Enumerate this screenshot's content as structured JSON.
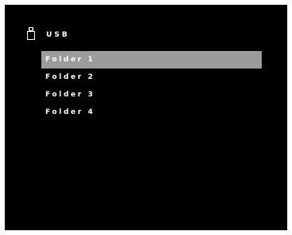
{
  "header": {
    "icon": "usb-drive-icon",
    "title": "USB"
  },
  "folders": [
    {
      "label": "Folder 1",
      "selected": true
    },
    {
      "label": "Folder 2",
      "selected": false
    },
    {
      "label": "Folder 3",
      "selected": false
    },
    {
      "label": "Folder 4",
      "selected": false
    }
  ],
  "colors": {
    "background": "#000000",
    "text": "#ffffff",
    "selection": "#9c9c9c"
  }
}
